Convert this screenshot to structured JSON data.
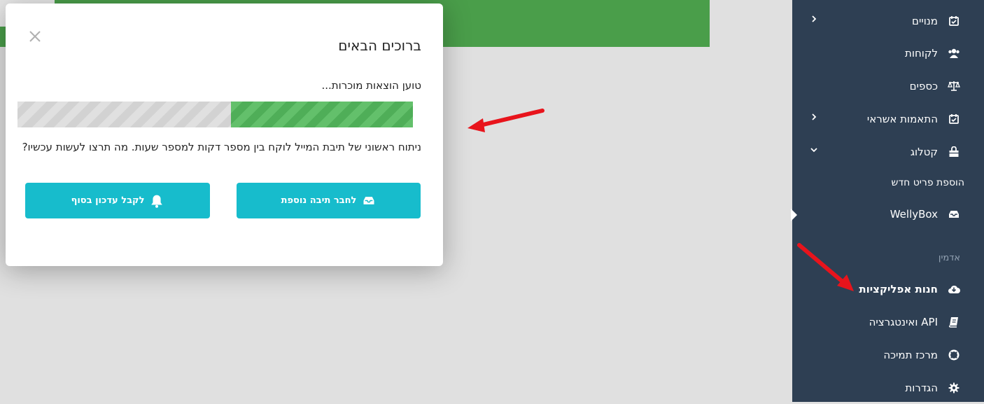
{
  "colors": {
    "sidebar_bg": "#2e3f53",
    "accent_teal": "#17bccc",
    "banner_green": "#4a9e4a",
    "progress_green": "#5cb85c",
    "annotation_red": "#e8141c"
  },
  "modal": {
    "title": "ברוכים הבאים",
    "close_icon": "close-icon",
    "loading_text": "טוען הוצאות מוכרות...",
    "progress_fraction": 0.46,
    "description": "ניתוח ראשוני של תיבת המייל לוקח בין מספר דקות למספר שעות. מה תרצו לעשות עכשיו?",
    "buttons": [
      {
        "label": "לחבר תיבה נוספת",
        "icon": "inbox-icon"
      },
      {
        "label": "לקבל עדכון בסוף",
        "icon": "bell-icon"
      }
    ]
  },
  "sidebar": {
    "items": [
      {
        "label": "מנויים",
        "icon": "calendar-check-icon",
        "chevron": "chevron-left-icon"
      },
      {
        "label": "לקוחות",
        "icon": "users-icon"
      },
      {
        "label": "כספים",
        "icon": "balance-scale-icon"
      },
      {
        "label": "התאמות אשראי",
        "icon": "calendar-check-icon",
        "chevron": "chevron-left-icon"
      },
      {
        "label": "קטלוג",
        "icon": "shopping-bag-icon",
        "chevron": "chevron-down-icon"
      }
    ],
    "subitem": "הוספת פריט חדש",
    "active_item": {
      "label": "WellyBox",
      "icon": "inbox-icon"
    },
    "admin_section": "אדמין",
    "admin_items": [
      {
        "label": "חנות אפליקציות",
        "icon": "cloud-download-icon"
      },
      {
        "label": "API ואינטגרציה",
        "icon": "book-icon"
      },
      {
        "label": "מרכז תמיכה",
        "icon": "life-ring-icon"
      },
      {
        "label": "הגדרות",
        "icon": "gear-icon"
      }
    ]
  }
}
